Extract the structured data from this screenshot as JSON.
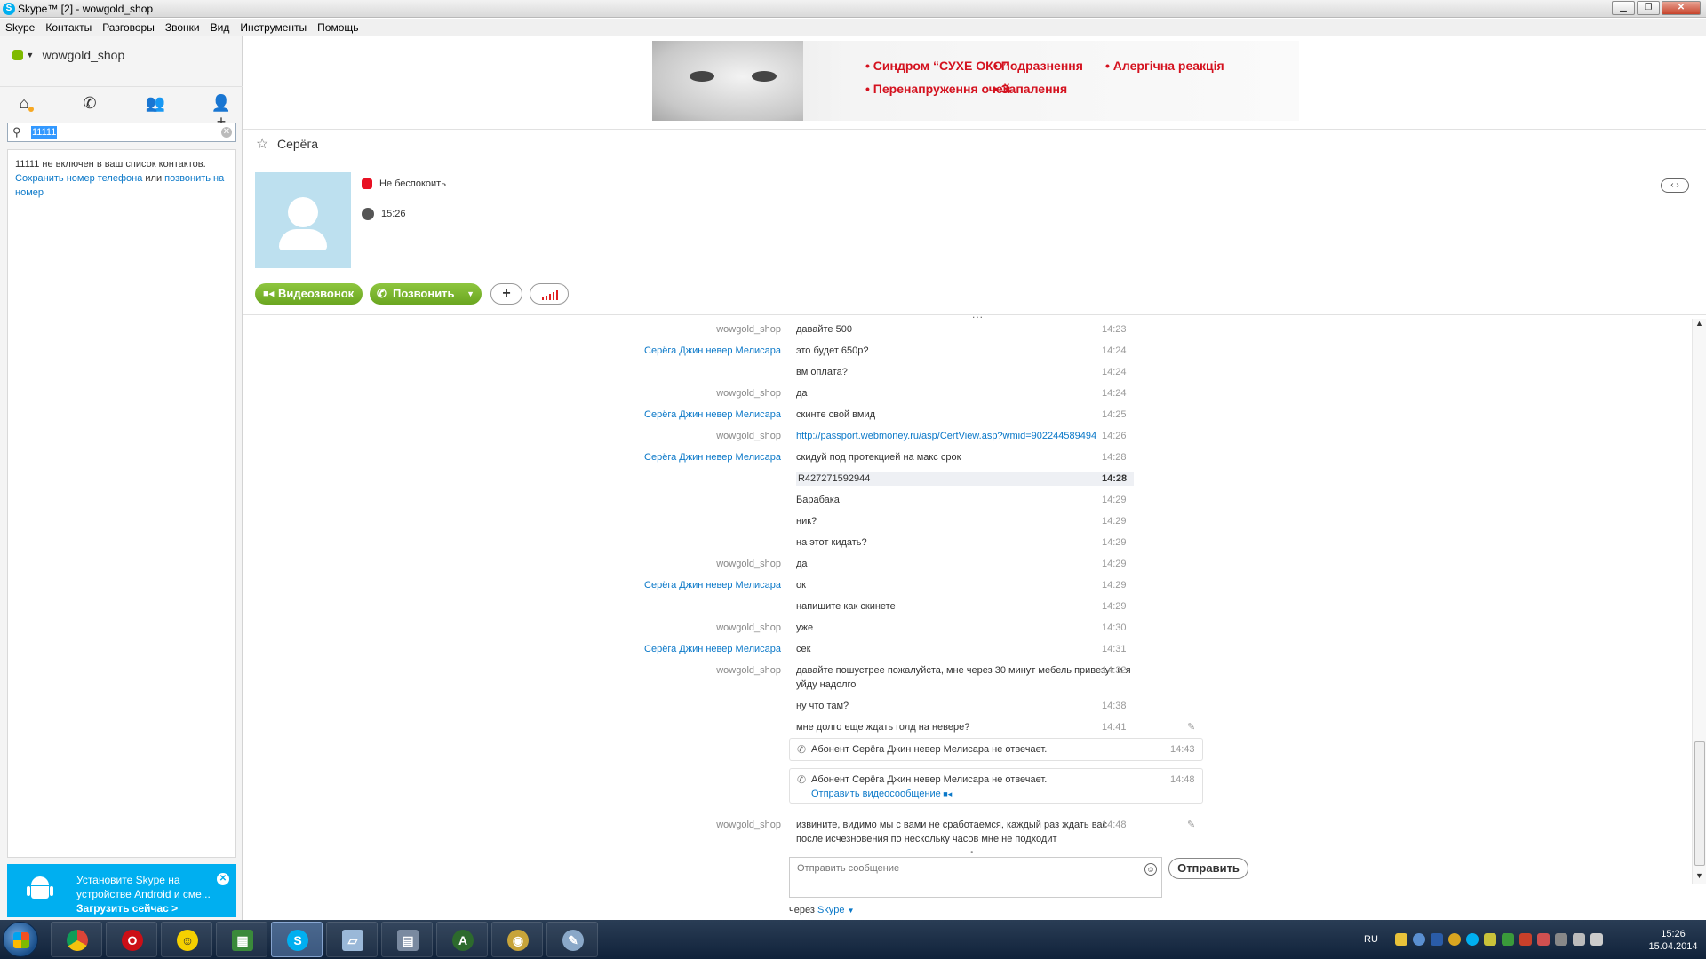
{
  "window": {
    "title": "Skype™ [2] - wowgold_shop",
    "logo": "S"
  },
  "menu": [
    "Skype",
    "Контакты",
    "Разговоры",
    "Звонки",
    "Вид",
    "Инструменты",
    "Помощь"
  ],
  "profile": {
    "name": "wowgold_shop"
  },
  "search": {
    "value": "11111"
  },
  "not_in_list": {
    "prefix": "11111 не включен в ваш список контактов.",
    "save_link": "Сохранить номер телефона",
    "or": " или ",
    "call_link": "позвонить на номер"
  },
  "android": {
    "line1": "Установите Skype на устройстве Android и сме...",
    "download": "Загрузить сейчас >"
  },
  "ad": {
    "items": [
      "• Синдром “СУХЕ ОКО”",
      "• Подразнення",
      "• Алергічна реакція",
      "• Перенапруження очей",
      "• Запалення"
    ]
  },
  "contact": {
    "name": "Серёга",
    "status": "Не беспокоить",
    "local_time": "15:26"
  },
  "actions": {
    "video": "Видеозвонок",
    "call": "Позвонить",
    "add": "+"
  },
  "messages": [
    {
      "author": "wowgold_shop",
      "text": "давайте 500",
      "time": "14:23",
      "me": true
    },
    {
      "author": "Серёга Джин невер Мелисара",
      "text": "это будет 650р?",
      "time": "14:24",
      "me": false
    },
    {
      "author": "",
      "text": "вм оплата?",
      "time": "14:24",
      "me": false
    },
    {
      "author": "wowgold_shop",
      "text": "да",
      "time": "14:24",
      "me": true
    },
    {
      "author": "Серёга Джин невер Мелисара",
      "text": "скинте свой вмид",
      "time": "14:25",
      "me": false
    },
    {
      "author": "wowgold_shop",
      "text": "http://passport.webmoney.ru/asp/CertView.asp?wmid=902244589494",
      "time": "14:26",
      "me": true,
      "link": true
    },
    {
      "author": "Серёга Джин невер Мелисара",
      "text": "скидуй под протекцией на макс срок",
      "time": "14:28",
      "me": false
    },
    {
      "author": "",
      "text": "R427271592944",
      "time": "14:28",
      "me": false,
      "highlight": true
    },
    {
      "author": "",
      "text": "Барабака",
      "time": "14:29",
      "me": false
    },
    {
      "author": "",
      "text": "ник?",
      "time": "14:29",
      "me": false
    },
    {
      "author": "",
      "text": "на этот кидать?",
      "time": "14:29",
      "me": false
    },
    {
      "author": "wowgold_shop",
      "text": "да",
      "time": "14:29",
      "me": true
    },
    {
      "author": "Серёга Джин невер Мелисара",
      "text": "ок",
      "time": "14:29",
      "me": false
    },
    {
      "author": "",
      "text": "напишите как скинете",
      "time": "14:29",
      "me": false
    },
    {
      "author": "wowgold_shop",
      "text": "уже",
      "time": "14:30",
      "me": true
    },
    {
      "author": "Серёга Джин невер Мелисара",
      "text": "сек",
      "time": "14:31",
      "me": false
    },
    {
      "author": "wowgold_shop",
      "text": "давайте пошустрее пожалуйста, мне через 30 минут мебель привезут и я уйду надолго",
      "time": "14:32",
      "me": true
    },
    {
      "author": "",
      "text": "ну что там?",
      "time": "14:38",
      "me": true
    },
    {
      "author": "",
      "text": "мне долго еще ждать голд на невере?",
      "time": "14:41",
      "me": true,
      "edited": true
    }
  ],
  "calls": [
    {
      "text": "Абонент Серёга Джин невер Мелисара не отвечает.",
      "time": "14:43"
    },
    {
      "text": "Абонент Серёга Джин невер Мелисара не отвечает.",
      "time": "14:48",
      "link": "Отправить видеосообщение"
    }
  ],
  "last_message": {
    "author": "wowgold_shop",
    "text": "извините, видимо мы с вами не сработаемся, каждый раз ждать вас после исчезновения по нескольку часов мне не подходит",
    "time": "14:48"
  },
  "composer": {
    "placeholder": "Отправить сообщение",
    "send": "Отправить",
    "via": "через",
    "via_link": "Skype"
  },
  "taskbar": {
    "lang": "RU",
    "time": "15:26",
    "date": "15.04.2014"
  }
}
